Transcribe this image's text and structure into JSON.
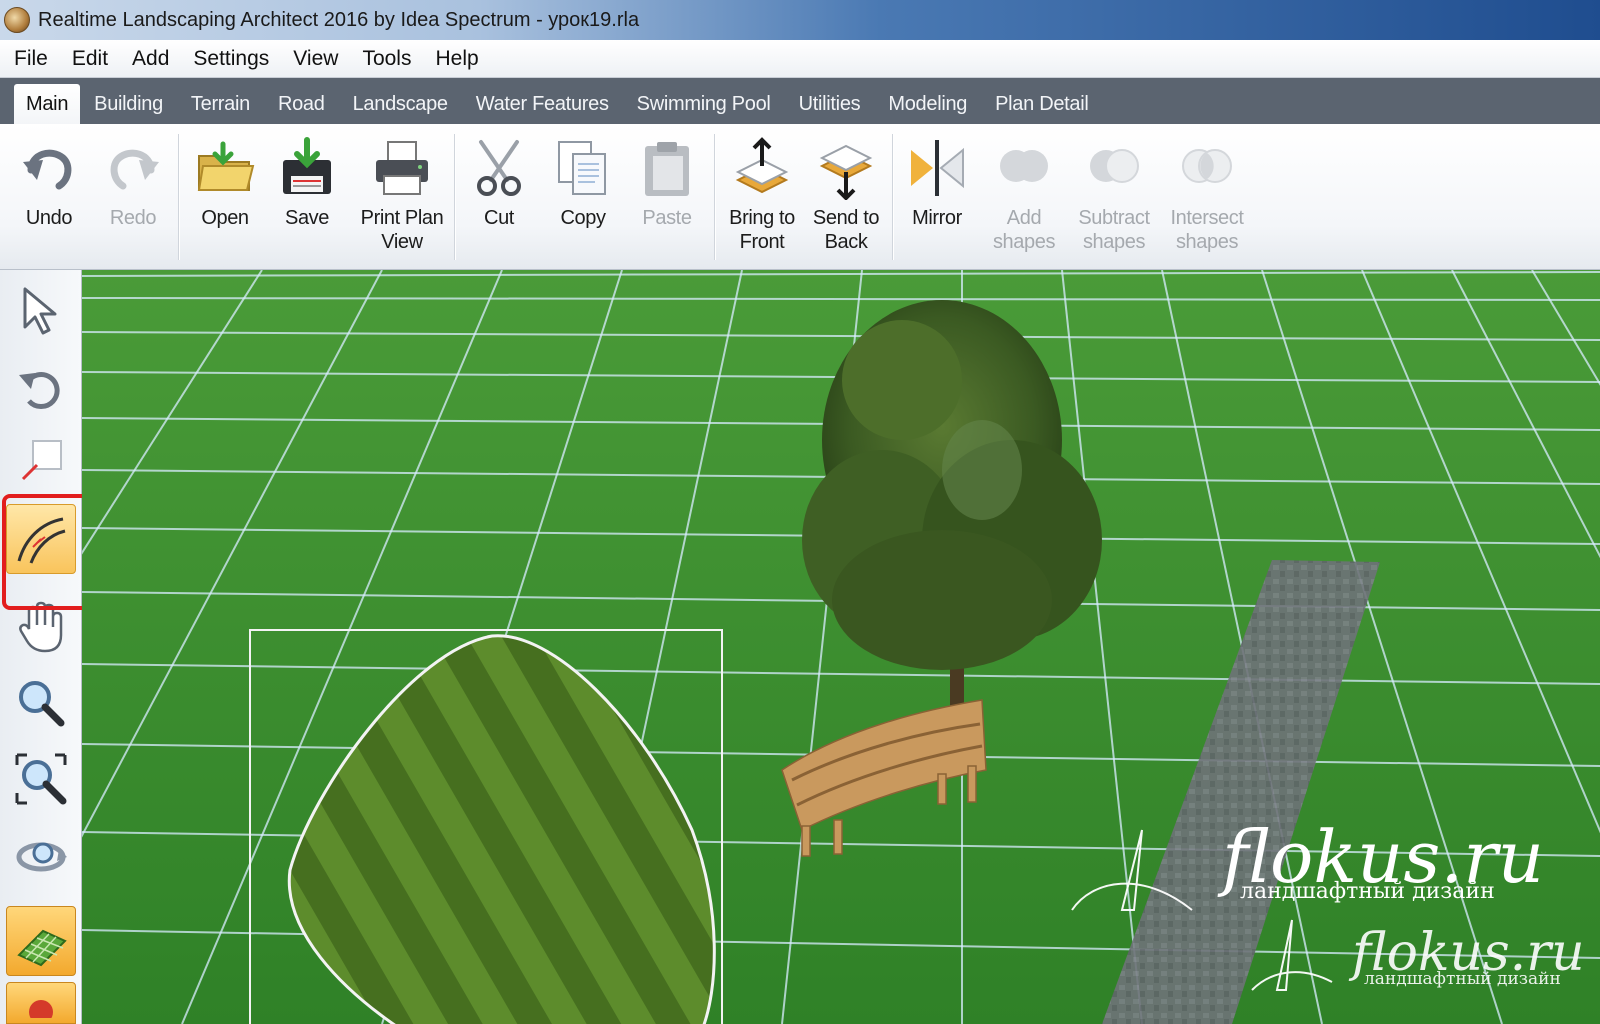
{
  "window": {
    "title": "Realtime Landscaping Architect 2016 by Idea Spectrum - урок19.rla"
  },
  "menu": [
    "File",
    "Edit",
    "Add",
    "Settings",
    "View",
    "Tools",
    "Help"
  ],
  "tabs": [
    {
      "label": "Main",
      "active": true
    },
    {
      "label": "Building"
    },
    {
      "label": "Terrain"
    },
    {
      "label": "Road"
    },
    {
      "label": "Landscape"
    },
    {
      "label": "Water Features"
    },
    {
      "label": "Swimming Pool"
    },
    {
      "label": "Utilities"
    },
    {
      "label": "Modeling"
    },
    {
      "label": "Plan Detail"
    }
  ],
  "ribbon": {
    "undo": "Undo",
    "redo": "Redo",
    "open": "Open",
    "save": "Save",
    "print_line1": "Print Plan",
    "print_line2": "View",
    "cut": "Cut",
    "copy": "Copy",
    "paste": "Paste",
    "bring_line1": "Bring to",
    "bring_line2": "Front",
    "send_line1": "Send to",
    "send_line2": "Back",
    "mirror": "Mirror",
    "add_line1": "Add",
    "add_line2": "shapes",
    "subtract_line1": "Subtract",
    "subtract_line2": "shapes",
    "intersect_line1": "Intersect",
    "intersect_line2": "shapes"
  },
  "left_tools": [
    {
      "icon": "select-arrow-icon"
    },
    {
      "icon": "rotate-icon"
    },
    {
      "icon": "resize-icon"
    },
    {
      "icon": "curve-edit-icon",
      "active": true
    },
    {
      "icon": "hand-pan-icon"
    },
    {
      "icon": "zoom-icon"
    },
    {
      "icon": "zoom-extents-icon"
    },
    {
      "icon": "orbit-icon"
    },
    {
      "icon": "grid-plane-icon"
    }
  ],
  "watermark": {
    "brand": "flokus.ru",
    "tagline": "ландшафтный дизайн"
  },
  "colors": {
    "grass": "#3d8f2f",
    "grid_line": "#d8ecff",
    "highlight": "#e21d1d",
    "active_tool": "#f9c45c"
  }
}
